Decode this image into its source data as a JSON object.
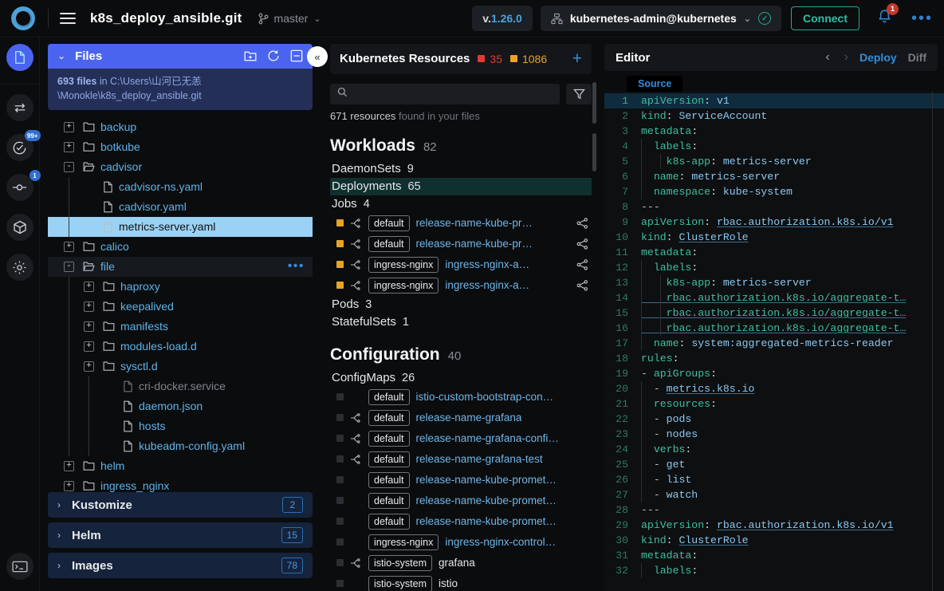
{
  "topbar": {
    "project_title": "k8s_deploy_ansible.git",
    "branch": "master",
    "version_prefix": "v.",
    "version": "1.26.0",
    "cluster_context": "kubernetes-admin@kubernetes",
    "connect_label": "Connect",
    "notification_count": "1",
    "overflow_label": "•••"
  },
  "rail": {
    "items": [
      {
        "name": "files-icon",
        "badge": ""
      },
      {
        "name": "compare-icon",
        "badge": ""
      },
      {
        "name": "validation-icon",
        "badge": "99+"
      },
      {
        "name": "git-commit-icon",
        "badge": "1"
      },
      {
        "name": "images-cube-icon",
        "badge": ""
      },
      {
        "name": "settings-gear-icon",
        "badge": ""
      }
    ],
    "terminal": "terminal-icon"
  },
  "files": {
    "header_title": "Files",
    "count_text": "693 files",
    "location_prefix": " in ",
    "location_line1": "C:\\Users\\山河已无恙",
    "location_line2": "\\Monokle\\k8s_deploy_ansible.git",
    "actions": [
      "new-folder-icon",
      "refresh-icon",
      "collapse-all-icon"
    ],
    "tree": [
      {
        "label": "backup",
        "type": "folder",
        "depth": 0,
        "expander": "+",
        "state": ""
      },
      {
        "label": "botkube",
        "type": "folder",
        "depth": 0,
        "expander": "+",
        "state": ""
      },
      {
        "label": "cadvisor",
        "type": "folder-open",
        "depth": 0,
        "expander": "-",
        "state": ""
      },
      {
        "label": "cadvisor-ns.yaml",
        "type": "file",
        "depth": 1,
        "expander": "",
        "state": ""
      },
      {
        "label": "cadvisor.yaml",
        "type": "file",
        "depth": 1,
        "expander": "",
        "state": ""
      },
      {
        "label": "metrics-server.yaml",
        "type": "file",
        "depth": 1,
        "expander": "",
        "state": "selected"
      },
      {
        "label": "calico",
        "type": "folder",
        "depth": 0,
        "expander": "+",
        "state": ""
      },
      {
        "label": "file",
        "type": "folder-open",
        "depth": 0,
        "expander": "-",
        "state": "hovered"
      },
      {
        "label": "haproxy",
        "type": "folder",
        "depth": 1,
        "expander": "+",
        "state": ""
      },
      {
        "label": "keepalived",
        "type": "folder",
        "depth": 1,
        "expander": "+",
        "state": ""
      },
      {
        "label": "manifests",
        "type": "folder",
        "depth": 1,
        "expander": "+",
        "state": ""
      },
      {
        "label": "modules-load.d",
        "type": "folder",
        "depth": 1,
        "expander": "+",
        "state": ""
      },
      {
        "label": "sysctl.d",
        "type": "folder",
        "depth": 1,
        "expander": "+",
        "state": ""
      },
      {
        "label": "cri-docker.service",
        "type": "file-dim",
        "depth": 2,
        "expander": "",
        "state": ""
      },
      {
        "label": "daemon.json",
        "type": "file",
        "depth": 2,
        "expander": "",
        "state": ""
      },
      {
        "label": "hosts",
        "type": "file",
        "depth": 2,
        "expander": "",
        "state": ""
      },
      {
        "label": "kubeadm-config.yaml",
        "type": "file",
        "depth": 2,
        "expander": "",
        "state": ""
      },
      {
        "label": "helm",
        "type": "folder",
        "depth": 0,
        "expander": "+",
        "state": ""
      },
      {
        "label": "ingress_nginx",
        "type": "folder",
        "depth": 0,
        "expander": "+",
        "state": ""
      }
    ],
    "accordions": [
      {
        "label": "Kustomize",
        "count": "2"
      },
      {
        "label": "Helm",
        "count": "15"
      },
      {
        "label": "Images",
        "count": "78"
      }
    ]
  },
  "collapse_knob": "«",
  "resources": {
    "title": "Kubernetes Resources",
    "error_count": "35",
    "warning_count": "1086",
    "error_color": "#e03c31",
    "warning_color": "#e8a427",
    "add_label": "+",
    "search_placeholder": "",
    "search_value": "",
    "found_count": "671 resources",
    "found_suffix": " found in your files",
    "sections": [
      {
        "title": "Workloads",
        "count": "82",
        "kinds": [
          {
            "label": "DaemonSets",
            "count": "9",
            "highlight": false,
            "items": []
          },
          {
            "label": "Deployments",
            "count": "65",
            "highlight": true,
            "items": []
          },
          {
            "label": "Jobs",
            "count": "4",
            "highlight": false,
            "items": [
              {
                "status": "warning",
                "link": true,
                "ns": "default",
                "name": "release-name-kube-pr…",
                "share": true,
                "plain": false
              },
              {
                "status": "warning",
                "link": true,
                "ns": "default",
                "name": "release-name-kube-pr…",
                "share": true,
                "plain": false
              },
              {
                "status": "warning",
                "link": true,
                "ns": "ingress-nginx",
                "name": "ingress-nginx-a…",
                "share": true,
                "plain": false
              },
              {
                "status": "warning",
                "link": true,
                "ns": "ingress-nginx",
                "name": "ingress-nginx-a…",
                "share": true,
                "plain": false
              }
            ]
          },
          {
            "label": "Pods",
            "count": "3",
            "highlight": false,
            "items": []
          },
          {
            "label": "StatefulSets",
            "count": "1",
            "highlight": false,
            "items": []
          }
        ]
      },
      {
        "title": "Configuration",
        "count": "40",
        "kinds": [
          {
            "label": "ConfigMaps",
            "count": "26",
            "highlight": false,
            "items": [
              {
                "status": "none",
                "link": false,
                "ns": "default",
                "name": "istio-custom-bootstrap-con…",
                "share": false,
                "plain": false
              },
              {
                "status": "none",
                "link": true,
                "ns": "default",
                "name": "release-name-grafana",
                "share": false,
                "plain": false
              },
              {
                "status": "none",
                "link": true,
                "ns": "default",
                "name": "release-name-grafana-confi…",
                "share": false,
                "plain": false
              },
              {
                "status": "none",
                "link": true,
                "ns": "default",
                "name": "release-name-grafana-test",
                "share": false,
                "plain": false
              },
              {
                "status": "none",
                "link": false,
                "ns": "default",
                "name": "release-name-kube-promet…",
                "share": false,
                "plain": false
              },
              {
                "status": "none",
                "link": false,
                "ns": "default",
                "name": "release-name-kube-promet…",
                "share": false,
                "plain": false
              },
              {
                "status": "none",
                "link": false,
                "ns": "default",
                "name": "release-name-kube-promet…",
                "share": false,
                "plain": false
              },
              {
                "status": "none",
                "link": false,
                "ns": "ingress-nginx",
                "name": "ingress-nginx-control…",
                "share": false,
                "plain": false
              },
              {
                "status": "none",
                "link": true,
                "ns": "istio-system",
                "name": "grafana",
                "share": false,
                "plain": true
              },
              {
                "status": "none",
                "link": false,
                "ns": "istio-system",
                "name": "istio",
                "share": false,
                "plain": true
              }
            ]
          }
        ]
      }
    ]
  },
  "editor": {
    "title": "Editor",
    "prev_label": "‹",
    "next_label": "›",
    "deploy_label": "Deploy",
    "diff_label": "Diff",
    "tab_label": "Source",
    "current_line": 1,
    "lines": [
      {
        "n": 1,
        "indent": 0,
        "tokens": [
          {
            "t": "k",
            "s": "apiVersion"
          },
          {
            "t": "p",
            "s": ": "
          },
          {
            "t": "v",
            "s": "v1"
          }
        ]
      },
      {
        "n": 2,
        "indent": 0,
        "tokens": [
          {
            "t": "k",
            "s": "kind"
          },
          {
            "t": "p",
            "s": ": "
          },
          {
            "t": "v",
            "s": "ServiceAccount"
          }
        ]
      },
      {
        "n": 3,
        "indent": 0,
        "tokens": [
          {
            "t": "k",
            "s": "metadata"
          },
          {
            "t": "p",
            "s": ":"
          }
        ]
      },
      {
        "n": 4,
        "indent": 1,
        "tokens": [
          {
            "t": "k",
            "s": "  labels"
          },
          {
            "t": "p",
            "s": ":"
          }
        ]
      },
      {
        "n": 5,
        "indent": 2,
        "tokens": [
          {
            "t": "k",
            "s": "    k8s-app"
          },
          {
            "t": "p",
            "s": ": "
          },
          {
            "t": "v",
            "s": "metrics-server"
          }
        ]
      },
      {
        "n": 6,
        "indent": 1,
        "tokens": [
          {
            "t": "k",
            "s": "  name"
          },
          {
            "t": "p",
            "s": ": "
          },
          {
            "t": "v",
            "s": "metrics-server"
          }
        ]
      },
      {
        "n": 7,
        "indent": 1,
        "tokens": [
          {
            "t": "k",
            "s": "  namespace"
          },
          {
            "t": "p",
            "s": ": "
          },
          {
            "t": "v",
            "s": "kube-system"
          }
        ]
      },
      {
        "n": 8,
        "indent": 0,
        "tokens": [
          {
            "t": "dash",
            "s": "---"
          }
        ]
      },
      {
        "n": 9,
        "indent": 0,
        "tokens": [
          {
            "t": "k",
            "s": "apiVersion"
          },
          {
            "t": "p",
            "s": ": "
          },
          {
            "t": "vu",
            "s": "rbac.authorization.k8s.io/v1"
          }
        ]
      },
      {
        "n": 10,
        "indent": 0,
        "tokens": [
          {
            "t": "k",
            "s": "kind"
          },
          {
            "t": "p",
            "s": ": "
          },
          {
            "t": "vu",
            "s": "ClusterRole"
          }
        ]
      },
      {
        "n": 11,
        "indent": 0,
        "tokens": [
          {
            "t": "k",
            "s": "metadata"
          },
          {
            "t": "p",
            "s": ":"
          }
        ]
      },
      {
        "n": 12,
        "indent": 1,
        "tokens": [
          {
            "t": "k",
            "s": "  labels"
          },
          {
            "t": "p",
            "s": ":"
          }
        ]
      },
      {
        "n": 13,
        "indent": 2,
        "tokens": [
          {
            "t": "k",
            "s": "    k8s-app"
          },
          {
            "t": "p",
            "s": ": "
          },
          {
            "t": "v",
            "s": "metrics-server"
          }
        ]
      },
      {
        "n": 14,
        "indent": 2,
        "tokens": [
          {
            "t": "ku",
            "s": "    rbac.authorization.k8s.io/aggregate-t…"
          }
        ]
      },
      {
        "n": 15,
        "indent": 2,
        "tokens": [
          {
            "t": "ku",
            "s": "    rbac.authorization.k8s.io/aggregate-t…"
          }
        ]
      },
      {
        "n": 16,
        "indent": 2,
        "tokens": [
          {
            "t": "ku",
            "s": "    rbac.authorization.k8s.io/aggregate-t…"
          }
        ]
      },
      {
        "n": 17,
        "indent": 1,
        "tokens": [
          {
            "t": "k",
            "s": "  name"
          },
          {
            "t": "p",
            "s": ": "
          },
          {
            "t": "v",
            "s": "system:aggregated-metrics-reader"
          }
        ]
      },
      {
        "n": 18,
        "indent": 0,
        "tokens": [
          {
            "t": "k",
            "s": "rules"
          },
          {
            "t": "p",
            "s": ":"
          }
        ]
      },
      {
        "n": 19,
        "indent": 0,
        "tokens": [
          {
            "t": "dash",
            "s": "- "
          },
          {
            "t": "k",
            "s": "apiGroups"
          },
          {
            "t": "p",
            "s": ":"
          }
        ]
      },
      {
        "n": 20,
        "indent": 1,
        "tokens": [
          {
            "t": "dash",
            "s": "  - "
          },
          {
            "t": "vu",
            "s": "metrics.k8s.io"
          }
        ]
      },
      {
        "n": 21,
        "indent": 1,
        "tokens": [
          {
            "t": "k",
            "s": "  resources"
          },
          {
            "t": "p",
            "s": ":"
          }
        ]
      },
      {
        "n": 22,
        "indent": 1,
        "tokens": [
          {
            "t": "dash",
            "s": "  - "
          },
          {
            "t": "v",
            "s": "pods"
          }
        ]
      },
      {
        "n": 23,
        "indent": 1,
        "tokens": [
          {
            "t": "dash",
            "s": "  - "
          },
          {
            "t": "v",
            "s": "nodes"
          }
        ]
      },
      {
        "n": 24,
        "indent": 1,
        "tokens": [
          {
            "t": "k",
            "s": "  verbs"
          },
          {
            "t": "p",
            "s": ":"
          }
        ]
      },
      {
        "n": 25,
        "indent": 1,
        "tokens": [
          {
            "t": "dash",
            "s": "  - "
          },
          {
            "t": "v",
            "s": "get"
          }
        ]
      },
      {
        "n": 26,
        "indent": 1,
        "tokens": [
          {
            "t": "dash",
            "s": "  - "
          },
          {
            "t": "v",
            "s": "list"
          }
        ]
      },
      {
        "n": 27,
        "indent": 1,
        "tokens": [
          {
            "t": "dash",
            "s": "  - "
          },
          {
            "t": "v",
            "s": "watch"
          }
        ]
      },
      {
        "n": 28,
        "indent": 0,
        "tokens": [
          {
            "t": "dash",
            "s": "---"
          }
        ]
      },
      {
        "n": 29,
        "indent": 0,
        "tokens": [
          {
            "t": "k",
            "s": "apiVersion"
          },
          {
            "t": "p",
            "s": ": "
          },
          {
            "t": "vu",
            "s": "rbac.authorization.k8s.io/v1"
          }
        ]
      },
      {
        "n": 30,
        "indent": 0,
        "tokens": [
          {
            "t": "k",
            "s": "kind"
          },
          {
            "t": "p",
            "s": ": "
          },
          {
            "t": "vu",
            "s": "ClusterRole"
          }
        ]
      },
      {
        "n": 31,
        "indent": 0,
        "tokens": [
          {
            "t": "k",
            "s": "metadata"
          },
          {
            "t": "p",
            "s": ":"
          }
        ]
      },
      {
        "n": 32,
        "indent": 1,
        "tokens": [
          {
            "t": "k",
            "s": "  labels"
          },
          {
            "t": "p",
            "s": ":"
          }
        ]
      }
    ]
  }
}
